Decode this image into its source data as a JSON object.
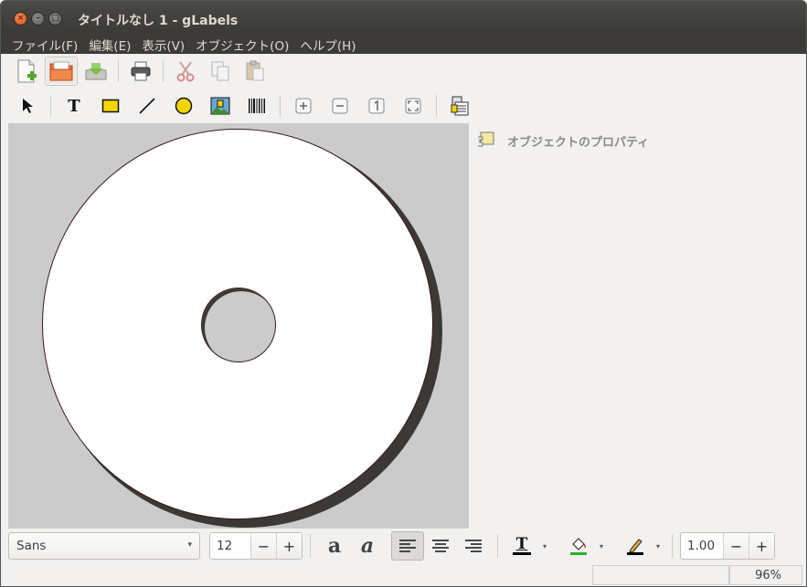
{
  "window": {
    "title": "タイトルなし 1 - gLabels",
    "close_label": "×",
    "minimize_label": "–",
    "maximize_label": "□"
  },
  "menubar": {
    "items": [
      {
        "label": "ファイル(F)"
      },
      {
        "label": "編集(E)"
      },
      {
        "label": "表示(V)"
      },
      {
        "label": "オブジェクト(O)"
      },
      {
        "label": "ヘルプ(H)"
      }
    ]
  },
  "toolbar_main": {
    "buttons": [
      "new-icon",
      "open-icon",
      "save-icon",
      "print-icon",
      "cut-icon",
      "copy-icon",
      "paste-icon"
    ]
  },
  "toolbar_drawing": {
    "buttons": [
      "arrow-icon",
      "text-icon",
      "box-icon",
      "line-icon",
      "ellipse-icon",
      "image-icon",
      "barcode-icon",
      "zoom-in-icon",
      "zoom-out-icon",
      "zoom-1to1-icon",
      "zoom-fit-icon",
      "merge-properties-icon"
    ],
    "text_tool_glyph": "T"
  },
  "properties_panel": {
    "title": "オブジェクトのプロパティ"
  },
  "format_bar": {
    "font_family": "Sans",
    "font_size": "12",
    "minus": "−",
    "plus": "+",
    "bold_glyph": "a",
    "italic_glyph": "a",
    "text_color_glyph": "T",
    "line_width": "1.00",
    "combo_arrow": "▾",
    "text_color_accent": "#000000",
    "fill_color_accent": "#27b327",
    "line_color_accent": "#000000"
  },
  "statusbar": {
    "zoom": "96%"
  }
}
